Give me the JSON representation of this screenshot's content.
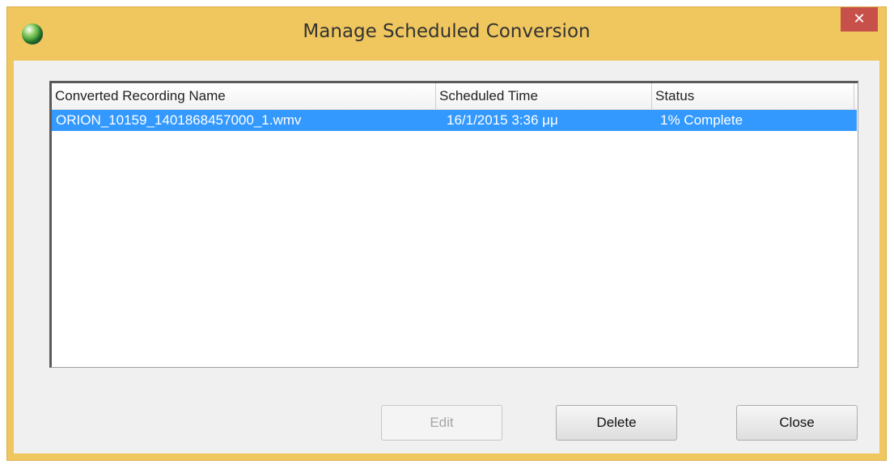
{
  "window": {
    "title": "Manage Scheduled Conversion",
    "close_glyph": "✕"
  },
  "listview": {
    "columns": [
      "Converted Recording Name",
      "Scheduled Time",
      "Status"
    ],
    "rows": [
      {
        "name": "ORION_10159_1401868457000_1.wmv",
        "scheduled_time": "16/1/2015 3:36 μμ",
        "status": "1% Complete",
        "selected": true
      }
    ]
  },
  "buttons": {
    "edit": "Edit",
    "delete": "Delete",
    "close": "Close"
  },
  "colors": {
    "titlebar": "#f0c75e",
    "close_button": "#c7504a",
    "selection": "#3399ff"
  },
  "icons": {
    "app": "globe-icon",
    "close": "close-icon"
  }
}
